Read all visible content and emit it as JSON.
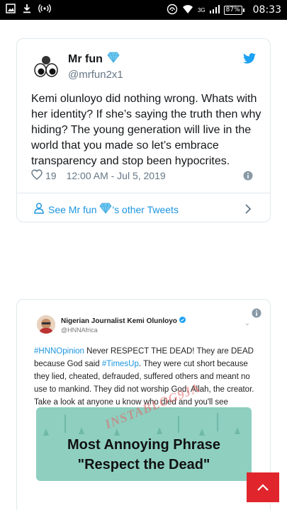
{
  "status_bar": {
    "battery": "87%",
    "network": "3G",
    "time": "08:33"
  },
  "tweet": {
    "name": "Mr fun",
    "handle": "@mrfun2x1",
    "text": "Kemi olunloyo did nothing wrong. Whats with her identity? If she’s saying the truth then why hiding? The young generation will live in the world that you made so let’s embrace transparency and stop been hypocrites.",
    "likes": "19",
    "datetime": "12:00 AM - Jul 5, 2019",
    "other_tweets_label_pre": "See Mr fun",
    "other_tweets_label_post": "'s other Tweets"
  },
  "embedded_screenshot": {
    "name": "Nigerian Journalist Kemi Olunloyo",
    "handle": "@HNNAfrica",
    "hashtag1": "#HNNOpinion",
    "text1": " Never RESPECT THE DEAD! They are DEAD because God said ",
    "hashtag2": "#TimesUp",
    "text2": ". They were cut short because they lied, cheated, defrauded, suffered others and meant no use to mankind. They did not worship God, Allah, the creator. Take a look at anyone u know who died and you'll see",
    "image_line1": "Most Annoying Phrase",
    "image_line2": "\"Respect the Dead\"",
    "watermark": "INSTABLOG9JA"
  },
  "colors": {
    "twitter_blue": "#1da1f2",
    "link_blue": "#1b95e0",
    "scroll_button": "#e0262c"
  }
}
